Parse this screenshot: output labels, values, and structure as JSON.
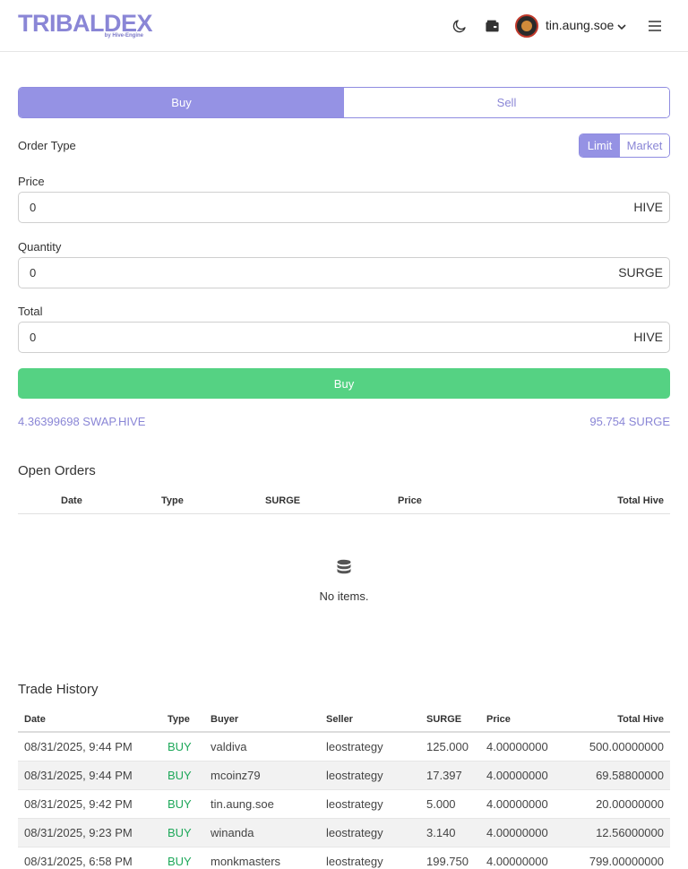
{
  "header": {
    "logo_text": "TRIBALDEX",
    "logo_sub": "by Hive-Engine",
    "username": "tin.aung.soe",
    "icons": [
      "moon-icon",
      "wallet-icon",
      "chevron-down-icon",
      "menu-icon"
    ]
  },
  "tabs": {
    "buy": "Buy",
    "sell": "Sell",
    "active": "Buy"
  },
  "order_type": {
    "label": "Order Type",
    "limit": "Limit",
    "market": "Market",
    "selected": "Limit"
  },
  "price": {
    "label": "Price",
    "value": "0",
    "unit": "HIVE"
  },
  "quantity": {
    "label": "Quantity",
    "value": "0",
    "unit": "SURGE"
  },
  "total": {
    "label": "Total",
    "value": "0",
    "unit": "HIVE"
  },
  "submit_label": "Buy",
  "balances": {
    "left": "4.36399698 SWAP.HIVE",
    "right": "95.754 SURGE"
  },
  "open_orders": {
    "title": "Open Orders",
    "columns": [
      "Date",
      "Type",
      "SURGE",
      "Price",
      "Total Hive"
    ],
    "empty_text": "No items."
  },
  "trade_history": {
    "title": "Trade History",
    "columns": [
      "Date",
      "Type",
      "Buyer",
      "Seller",
      "SURGE",
      "Price",
      "Total Hive"
    ],
    "rows": [
      [
        "08/31/2025, 9:44 PM",
        "BUY",
        "valdiva",
        "leostrategy",
        "125.000",
        "4.00000000",
        "500.00000000"
      ],
      [
        "08/31/2025, 9:44 PM",
        "BUY",
        "mcoinz79",
        "leostrategy",
        "17.397",
        "4.00000000",
        "69.58800000"
      ],
      [
        "08/31/2025, 9:42 PM",
        "BUY",
        "tin.aung.soe",
        "leostrategy",
        "5.000",
        "4.00000000",
        "20.00000000"
      ],
      [
        "08/31/2025, 9:23 PM",
        "BUY",
        "winanda",
        "leostrategy",
        "3.140",
        "4.00000000",
        "12.56000000"
      ],
      [
        "08/31/2025, 6:58 PM",
        "BUY",
        "monkmasters",
        "leostrategy",
        "199.750",
        "4.00000000",
        "799.00000000"
      ]
    ]
  },
  "colors": {
    "accent": "#9592e4",
    "buy_green": "#55d283",
    "type_green": "#1ea85a"
  }
}
